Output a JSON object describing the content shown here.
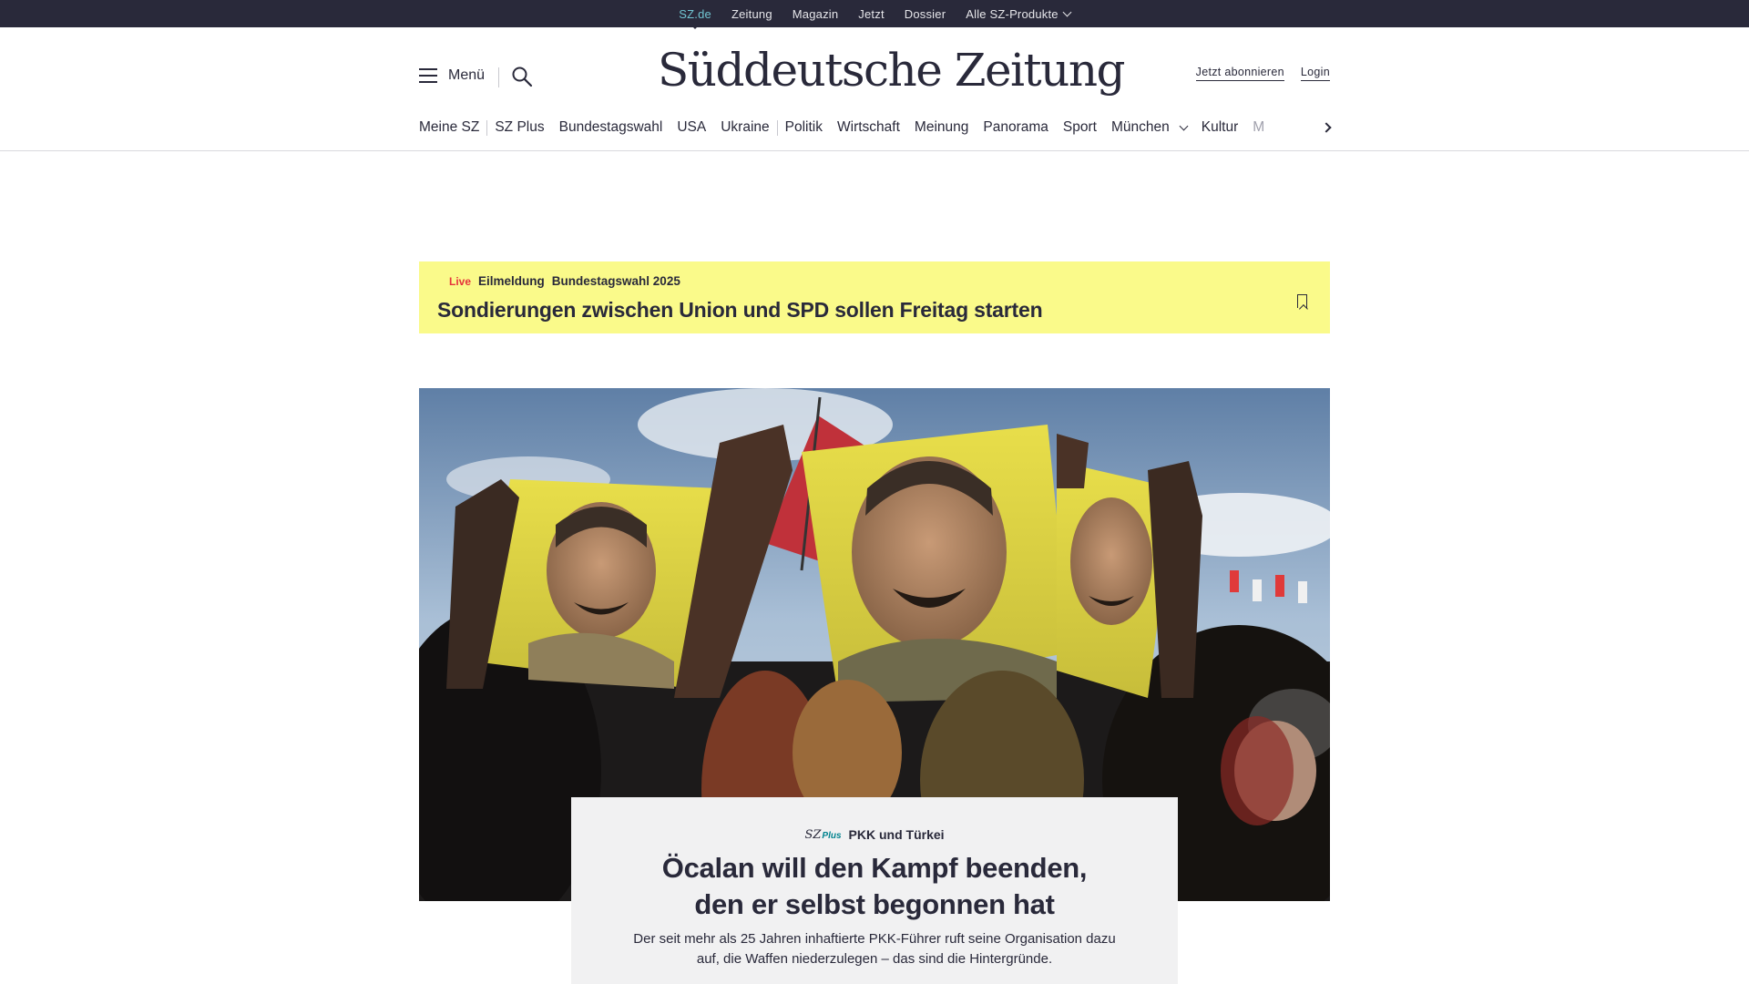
{
  "topbar": {
    "links": [
      {
        "label": "SZ.de",
        "active": true
      },
      {
        "label": "Zeitung"
      },
      {
        "label": "Magazin"
      },
      {
        "label": "Jetzt"
      },
      {
        "label": "Dossier"
      },
      {
        "label": "Alle SZ-Produkte",
        "has_dropdown": true
      }
    ]
  },
  "header": {
    "menu_label": "Menü",
    "search_icon": "search-icon",
    "logo_text": "Süddeutsche Zeitung",
    "subscribe_label": "Jetzt abonnieren",
    "login_label": "Login"
  },
  "nav": {
    "items": [
      {
        "label": "Meine SZ"
      },
      {
        "label": "SZ Plus"
      },
      {
        "label": "Bundestagswahl"
      },
      {
        "label": "USA"
      },
      {
        "label": "Ukraine"
      },
      {
        "label": "Politik"
      },
      {
        "label": "Wirtschaft"
      },
      {
        "label": "Meinung"
      },
      {
        "label": "Panorama"
      },
      {
        "label": "Sport"
      },
      {
        "label": "München",
        "has_dropdown": true
      },
      {
        "label": "Kultur"
      },
      {
        "label": "M"
      }
    ],
    "next_icon": "chevron-right-icon"
  },
  "breaking": {
    "live_label": "Live",
    "type_label": "Eilmeldung",
    "topic_label": "Bundestagswahl 2025",
    "headline": "Sondierungen zwischen Union und SPD sollen Freitag starten",
    "bookmark_icon": "bookmark-icon",
    "background_color": "#fafa8a"
  },
  "hero": {
    "image_subject": "protest-crowd-holding-yellow-portrait-flags"
  },
  "teaser": {
    "badge_sz": "SZ",
    "badge_plus": "Plus",
    "kicker": "PKK und Türkei",
    "title_line1": "Öcalan will den Kampf beenden,",
    "title_line2": "den er selbst begonnen hat",
    "description": "Der seit mehr als 25 Jahren inhaftierte PKK-Führer ruft seine Organisation dazu auf, die Waffen niederzulegen – das sind die Hintergründe."
  },
  "colors": {
    "ink": "#29293a",
    "topbar_bg": "#29293a",
    "active_link": "#71c5d2",
    "live_red": "#e5333b",
    "szplus_teal": "#00838f",
    "teaser_bg": "#f1f1f2"
  }
}
